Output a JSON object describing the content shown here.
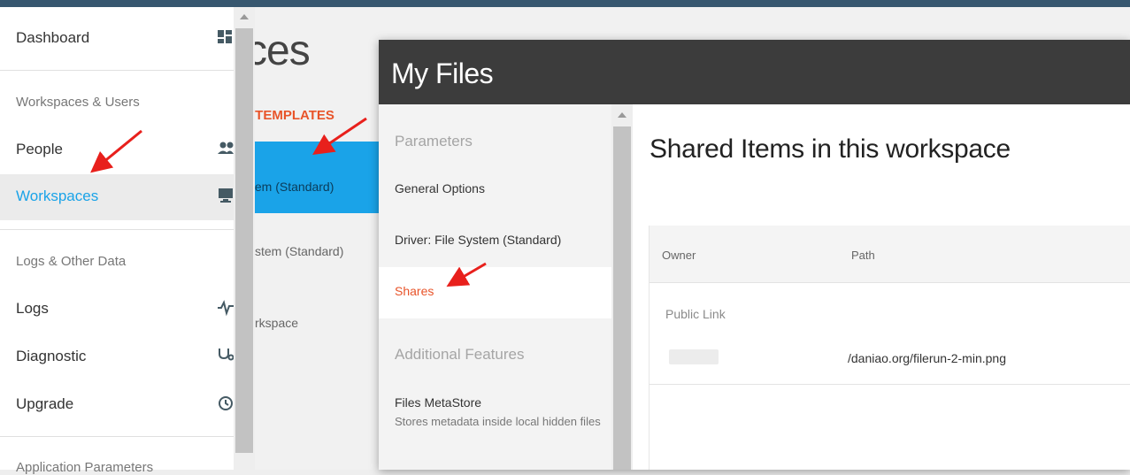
{
  "sidebar": {
    "dashboard_label": "Dashboard",
    "section_workspaces_users": "Workspaces & Users",
    "people_label": "People",
    "workspaces_label": "Workspaces",
    "section_logs": "Logs & Other Data",
    "logs_label": "Logs",
    "diagnostic_label": "Diagnostic",
    "upgrade_label": "Upgrade",
    "section_app_params": "Application Parameters",
    "active_color": "#1aa3e8"
  },
  "background_page": {
    "heading_fragment": "ces",
    "tab_fragment": "E TEMPLATES",
    "row1_fragment": "tem (Standard)",
    "row2_fragment": "stem (Standard)",
    "row3_fragment": "rkspace"
  },
  "modal": {
    "title": "My Files",
    "nav": {
      "section_parameters": "Parameters",
      "general_options": "General Options",
      "driver": "Driver: File System (Standard)",
      "shares": "Shares",
      "section_additional": "Additional Features",
      "metastore_title": "Files MetaStore",
      "metastore_desc": "Stores metadata inside local hidden files"
    },
    "content": {
      "title": "Shared Items in this workspace",
      "columns": [
        "Owner",
        "Path"
      ],
      "group_label": "Public Link",
      "rows": [
        {
          "owner": "",
          "path": "/daniao.org/filerun-2-min.png"
        }
      ]
    }
  },
  "colors": {
    "accent_orange": "#e8542a",
    "header_dark": "#3c3c3c",
    "topbar": "#37576f",
    "annotation_arrow": "#e8201c"
  }
}
